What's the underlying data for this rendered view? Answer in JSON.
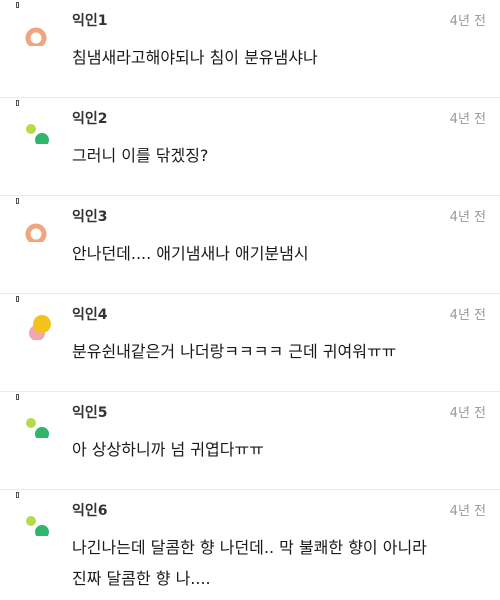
{
  "comments": [
    {
      "author": "익인1",
      "time": "4년 전",
      "lines": [
        "침냄새라고해야되나 침이 분유냄샤나"
      ],
      "avatar": "orange-ring"
    },
    {
      "author": "익인2",
      "time": "4년 전",
      "lines": [
        "그러니 이를 닦겠징?"
      ],
      "avatar": "green-dots"
    },
    {
      "author": "익인3",
      "time": "4년 전",
      "lines": [
        "안나던데.... 애기냄새나 애기분냄시"
      ],
      "avatar": "orange-ring"
    },
    {
      "author": "익인4",
      "time": "4년 전",
      "lines": [
        "분유쉰내같은거 나더랑ㅋㅋㅋㅋ 근데 귀여워ㅠㅠ"
      ],
      "avatar": "yellow-pink"
    },
    {
      "author": "익인5",
      "time": "4년 전",
      "lines": [
        "아 상상하니까 넘 귀엽다ㅠㅠ"
      ],
      "avatar": "green-dots"
    },
    {
      "author": "익인6",
      "time": "4년 전",
      "lines": [
        "나긴나는데 달콤한 향 나던데.. 막 불쾌한 향이 아니라",
        "진짜 달콤한 향 나...."
      ],
      "avatar": "green-dots"
    }
  ],
  "colors": {
    "orange": "#f2a47e",
    "green_light": "#b7d94a",
    "green_dark": "#2fb66a",
    "yellow": "#f4c21b",
    "pink": "#f2a7ac"
  }
}
